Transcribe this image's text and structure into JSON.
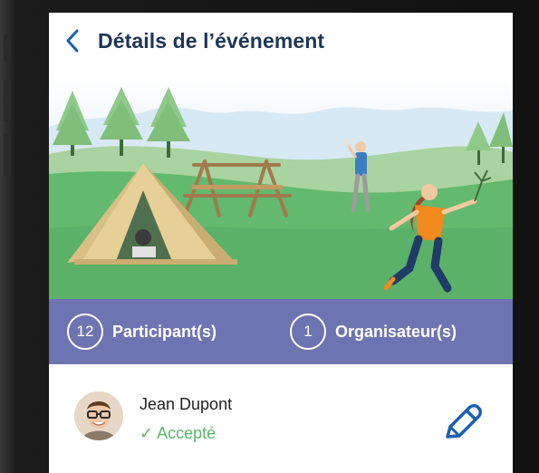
{
  "header": {
    "title": "Détails de l’événement"
  },
  "stats": {
    "participants": {
      "count": "12",
      "label": "Participant(s)"
    },
    "organizers": {
      "count": "1",
      "label": "Organisateur(s)"
    }
  },
  "member": {
    "name": "Jean Dupont",
    "status": "✓ Accepté"
  },
  "colors": {
    "title": "#1d3658",
    "accent_blue": "#1a5fb4",
    "stats_bar": "#6e74b1",
    "accepted": "#58b86a"
  }
}
